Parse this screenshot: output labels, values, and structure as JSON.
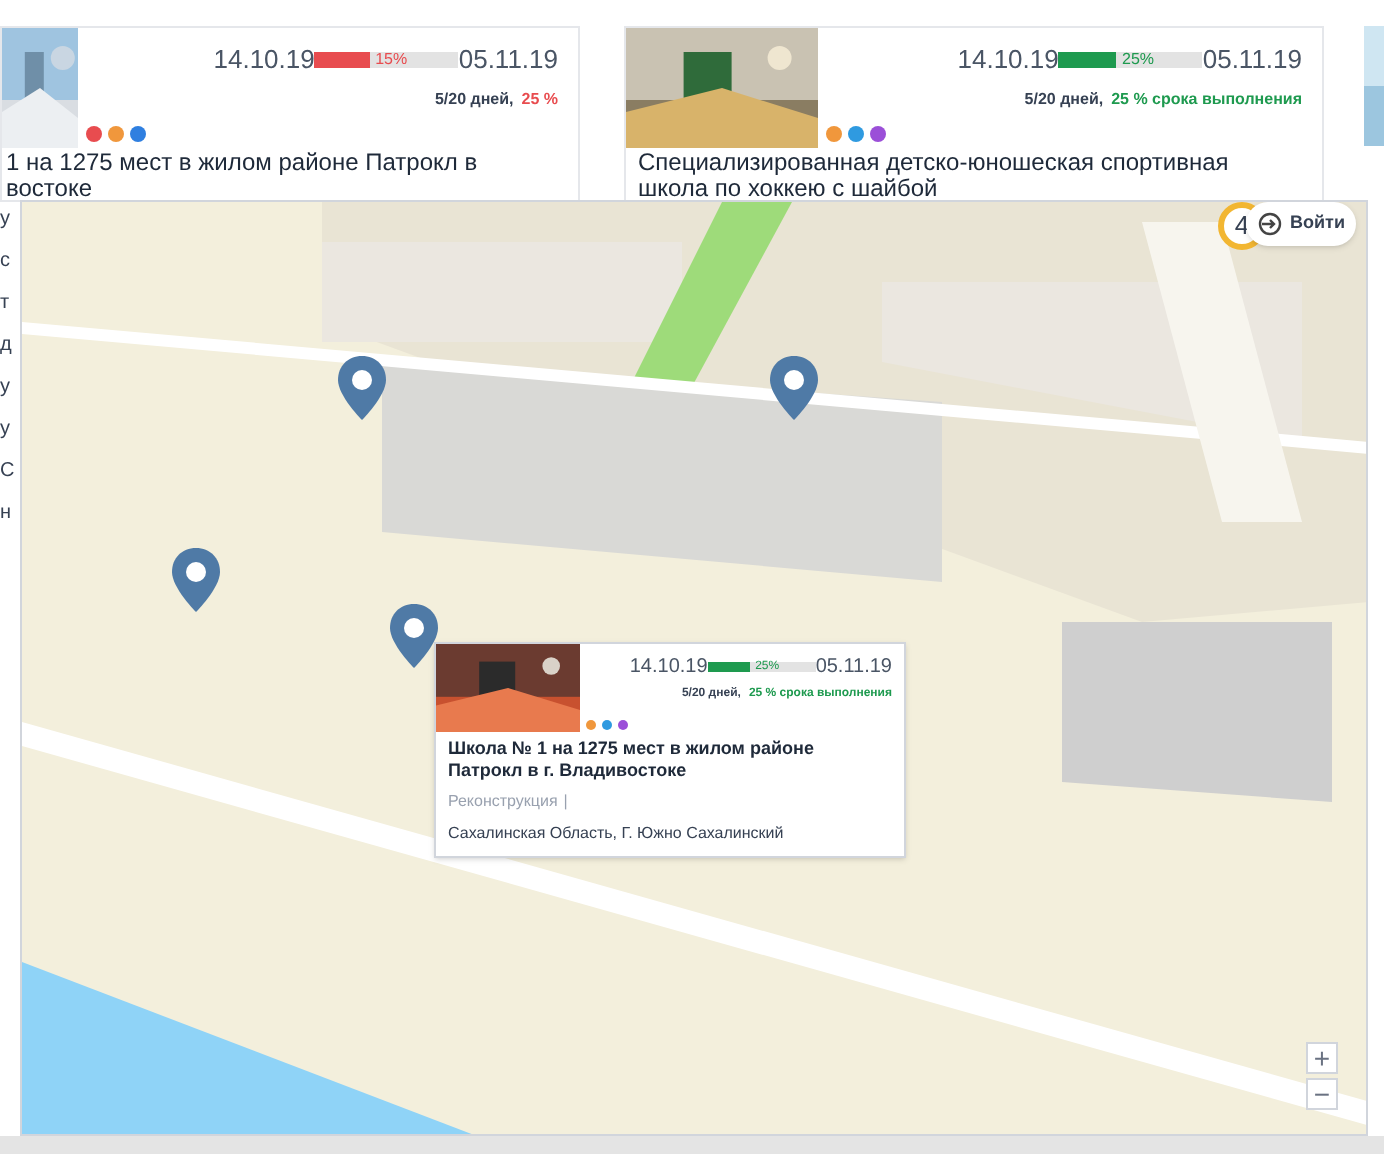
{
  "cards": [
    {
      "start": "14.10.19",
      "end": "05.11.19",
      "progress": {
        "level": 0.38,
        "label": "15%",
        "color": "#e84c4f"
      },
      "days": "5/20 дней,",
      "share": {
        "text": "25 %",
        "color": "#e84c4f"
      },
      "dots": [
        {
          "color": "#e84c4f"
        },
        {
          "color": "#f0973c"
        },
        {
          "color": "#2f7fe0"
        }
      ],
      "title_lines": [
        "1 на 1275 мест в жилом районе Патрокл в",
        "востоке"
      ]
    },
    {
      "start": "14.10.19",
      "end": "05.11.19",
      "progress": {
        "level": 0.4,
        "label": "25%",
        "color": "#1e9a4f"
      },
      "days": "5/20 дней,",
      "share": {
        "text": "25 % срока выполнения",
        "color": "#1e9a4f"
      },
      "dots": [
        {
          "color": "#f0973c"
        },
        {
          "color": "#2f9ae0"
        },
        {
          "color": "#9b4fd8"
        }
      ],
      "title_lines": [
        "Специализированная детско-юношеская спортивная",
        "школа по хоккею с шайбой"
      ]
    }
  ],
  "left_fragments": [
    "у",
    "с",
    "т",
    "д",
    "у",
    "у",
    "С",
    "н"
  ],
  "map": {
    "cluster": "4",
    "login": "Войти",
    "popup": {
      "start": "14.10.19",
      "end": "05.11.19",
      "progress": {
        "level": 0.4,
        "label": "25%",
        "color": "#1e9a4f"
      },
      "days": "5/20 дней,",
      "share": {
        "text": "25 % срока выполнения",
        "color": "#1e9a4f"
      },
      "dots": [
        {
          "color": "#f0973c"
        },
        {
          "color": "#2f9ae0"
        },
        {
          "color": "#9b4fd8"
        }
      ],
      "title": "Школа № 1 на 1275 мест в жилом районе Патрокл в г. Владивостоке",
      "type": "Реконструкция",
      "separator": "|",
      "address": "Сахалинская Область, Г. Южно Сахалинский"
    },
    "zoom": [
      "+",
      "−"
    ]
  }
}
